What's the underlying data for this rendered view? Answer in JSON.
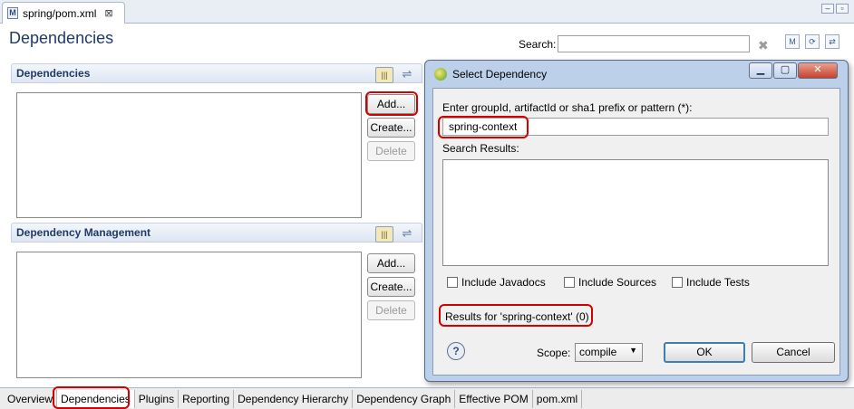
{
  "editor_tab": {
    "label": "spring/pom.xml",
    "close": "⊠"
  },
  "page": {
    "title": "Dependencies",
    "search_label": "Search:",
    "search_value": ""
  },
  "dependencies_section": {
    "title": "Dependencies",
    "buttons": {
      "add": "Add...",
      "create": "Create...",
      "delete": "Delete"
    }
  },
  "management_section": {
    "title": "Dependency Management",
    "buttons": {
      "add": "Add...",
      "create": "Create...",
      "delete": "Delete"
    }
  },
  "bottom_tabs": [
    {
      "label": "Overview",
      "active": false
    },
    {
      "label": "Dependencies",
      "active": true
    },
    {
      "label": "Plugins",
      "active": false
    },
    {
      "label": "Reporting",
      "active": false
    },
    {
      "label": "Dependency Hierarchy",
      "active": false
    },
    {
      "label": "Dependency Graph",
      "active": false
    },
    {
      "label": "Effective POM",
      "active": false
    },
    {
      "label": "pom.xml",
      "active": false
    }
  ],
  "dialog": {
    "title": "Select Dependency",
    "prompt": "Enter groupId, artifactId or sha1 prefix or pattern (*):",
    "query": "spring-context",
    "results_label": "Search Results:",
    "checkboxes": {
      "javadocs": "Include Javadocs",
      "sources": "Include Sources",
      "tests": "Include Tests"
    },
    "status": "Results for 'spring-context' (0)",
    "help": "?",
    "scope_label": "Scope:",
    "scope_value": "compile",
    "ok": "OK",
    "cancel": "Cancel"
  },
  "colors": {
    "highlight": "#d40000",
    "title_blue": "#1f3b66",
    "dialog_frame": "#bcd0ea"
  }
}
